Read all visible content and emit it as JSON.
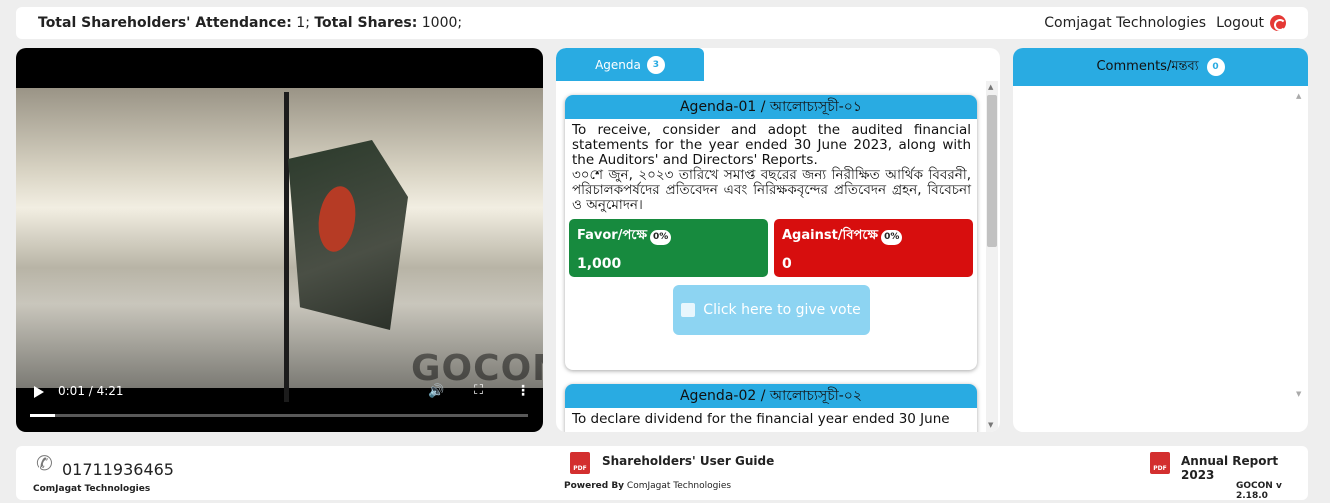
{
  "header": {
    "attendance_label": "Total Shareholders' Attendance:",
    "attendance_value": "1;",
    "shares_label": "Total Shares:",
    "shares_value": "1000;",
    "company": "Comjagat Technologies",
    "logout": "Logout"
  },
  "video": {
    "time": "0:01 / 4:21",
    "watermark": "GOCON",
    "progress": 0.05
  },
  "agenda": {
    "tab_label": "Agenda",
    "count": "3",
    "items": [
      {
        "title": "Agenda-01 / আলোচ্যসূচী-০১",
        "text_en": "To receive, consider and adopt the audited financial statements for the year ended 30 June 2023, along with the Auditors' and Directors' Reports.",
        "text_bn": "৩০শে জুন, ২০২৩ তারিখে সমাপ্ত বছরের জন্য নিরীক্ষিত আর্থিক বিবরনী, পরিচালকপর্ষদের প্রতিবেদন এবং নিরিক্ষকবৃন্দের প্রতিবেদন গ্রহন, বিবেচনা ও অনুমোদন।",
        "favor_label": "Favor/পক্ষে",
        "favor_pct": "0%",
        "favor_value": "1,000",
        "against_label": "Against/বিপক্ষে",
        "against_pct": "0%",
        "against_value": "0",
        "vote_button": "Click here to give vote"
      },
      {
        "title": "Agenda-02 / আলোচ্যসূচী-০২",
        "text_en": "To declare dividend for the financial year ended 30 June"
      }
    ]
  },
  "comments": {
    "title": "Comments/মন্তব্য",
    "count": "0"
  },
  "footer": {
    "phone": "01711936465",
    "company": "ComJagat Technologies",
    "guide": "Shareholders' User Guide",
    "powered_by": "Powered By",
    "powered_company": "ComJagat Technologies",
    "annual_report": "Annual Report 2023",
    "version": "GOCON v 2.18.0"
  }
}
